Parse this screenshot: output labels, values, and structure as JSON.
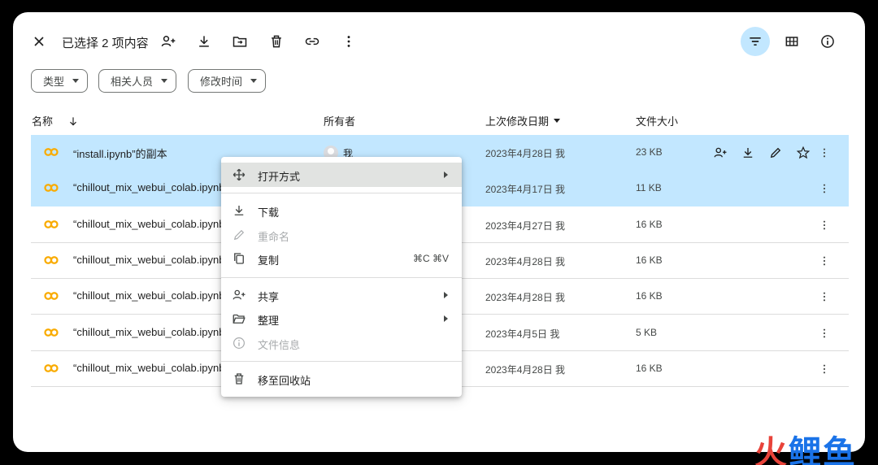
{
  "toolbar": {
    "selection_text": "已选择 2 项内容"
  },
  "filters": [
    {
      "label": "类型"
    },
    {
      "label": "相关人员"
    },
    {
      "label": "修改时间"
    }
  ],
  "columns": {
    "name": "名称",
    "owner": "所有者",
    "modified": "上次修改日期",
    "size": "文件大小"
  },
  "rows": [
    {
      "name": "“install.ipynb”的副本",
      "owner": "我",
      "date": "2023年4月28日 我",
      "size": "23 KB",
      "selected": true
    },
    {
      "name": "“chillout_mix_webui_colab.ipynb”",
      "owner": "",
      "date": "2023年4月17日 我",
      "size": "11 KB",
      "selected": true
    },
    {
      "name": "“chillout_mix_webui_colab.ipynb”",
      "owner": "",
      "date": "2023年4月27日 我",
      "size": "16 KB",
      "selected": false
    },
    {
      "name": "“chillout_mix_webui_colab.ipynb”",
      "owner": "",
      "date": "2023年4月28日 我",
      "size": "16 KB",
      "selected": false
    },
    {
      "name": "“chillout_mix_webui_colab.ipynb”",
      "owner": "",
      "date": "2023年4月28日 我",
      "size": "16 KB",
      "selected": false
    },
    {
      "name": "“chillout_mix_webui_colab.ipynb”",
      "owner": "",
      "date": "2023年4月5日 我",
      "size": "5 KB",
      "selected": false
    },
    {
      "name": "“chillout_mix_webui_colab.ipynb”",
      "owner": "",
      "date": "2023年4月28日 我",
      "size": "16 KB",
      "selected": false
    }
  ],
  "context_menu": {
    "open_with": "打开方式",
    "download": "下载",
    "rename": "重命名",
    "copy": "复制",
    "copy_shortcut": "⌘C ⌘V",
    "share": "共享",
    "organize": "整理",
    "file_info": "文件信息",
    "trash": "移至回收站"
  },
  "watermark": "火鲤鱼",
  "colors": {
    "selected_row": "#c2e7ff",
    "active_filter_button": "#c2e7ff",
    "colab_icon": "#f9ab00",
    "watermark_red": "#e8433a",
    "watermark_blue": "#1a73e8"
  }
}
